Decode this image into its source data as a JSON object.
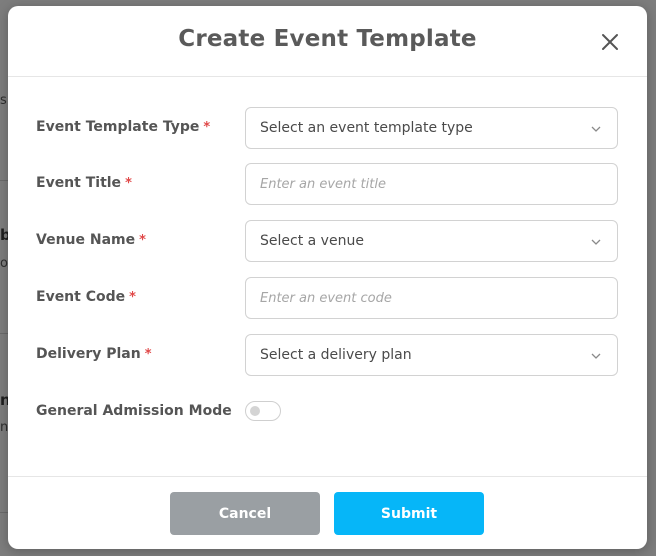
{
  "modal": {
    "title": "Create Event Template",
    "close_icon": "close-icon"
  },
  "background": {
    "fragments": [
      "s",
      "b",
      "o",
      "n",
      "n"
    ]
  },
  "form": {
    "template_type": {
      "label": "Event Template Type",
      "required_mark": "*",
      "value": "Select an event template type"
    },
    "event_title": {
      "label": "Event Title",
      "required_mark": "*",
      "placeholder": "Enter an event title"
    },
    "venue_name": {
      "label": "Venue Name",
      "required_mark": "*",
      "value": "Select a venue"
    },
    "event_code": {
      "label": "Event Code",
      "required_mark": "*",
      "placeholder": "Enter an event code"
    },
    "delivery_plan": {
      "label": "Delivery Plan",
      "required_mark": "*",
      "value": "Select a delivery plan"
    },
    "general_admission": {
      "label": "General Admission Mode",
      "enabled": false
    }
  },
  "footer": {
    "cancel_label": "Cancel",
    "submit_label": "Submit"
  },
  "colors": {
    "required": "#e04848",
    "submit": "#06b6f8",
    "cancel": "#9a9fa3",
    "title": "#5a5a5a"
  }
}
